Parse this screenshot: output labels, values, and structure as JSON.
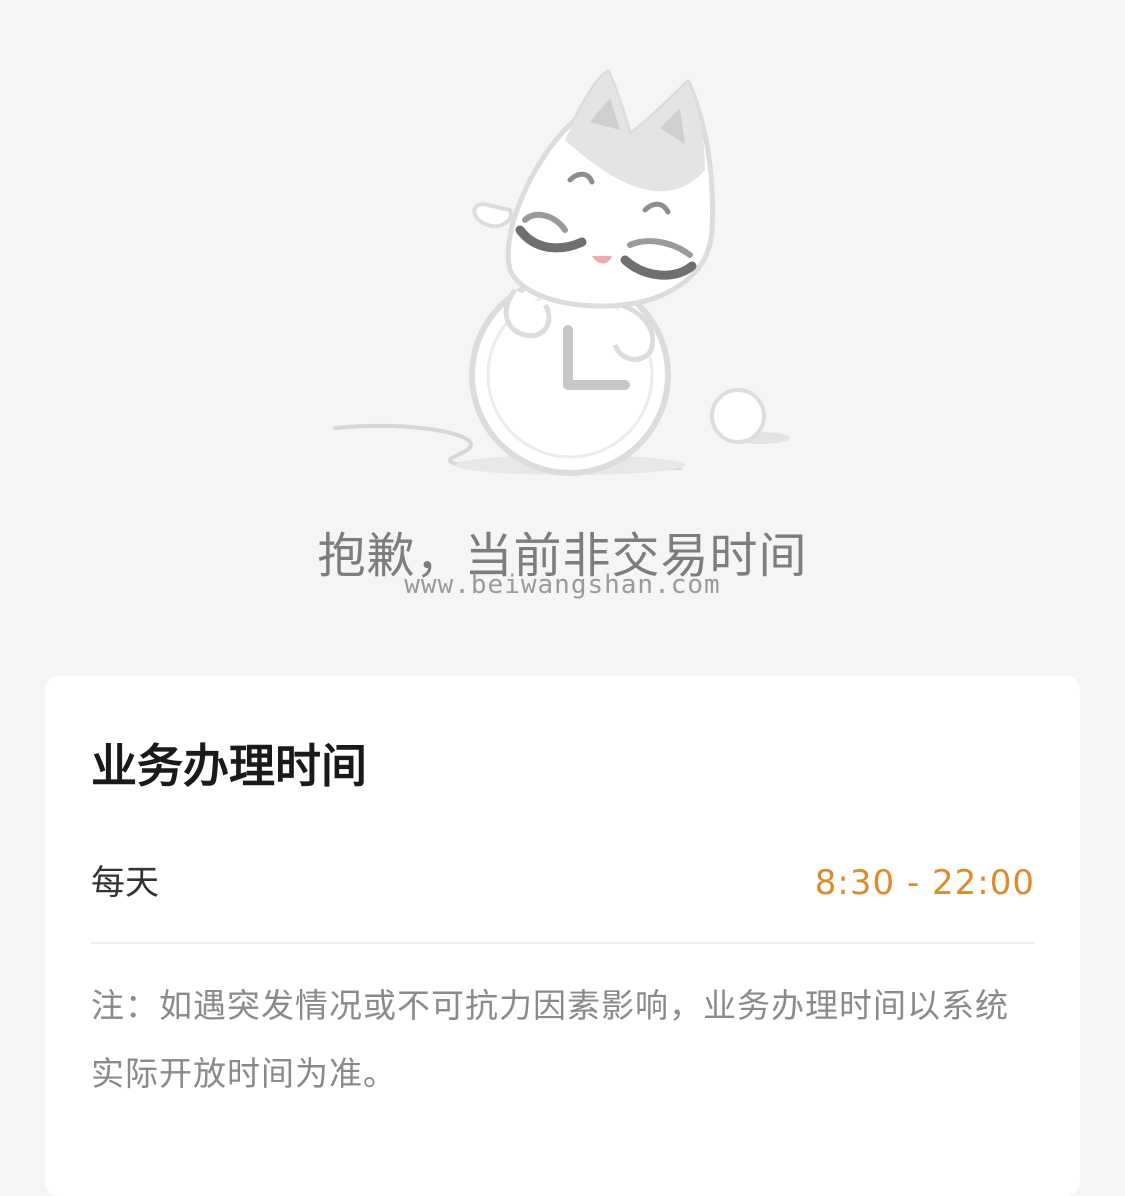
{
  "empty_state": {
    "illustration_icon": "sleeping-cat-clock-icon",
    "title": "抱歉，当前非交易时间",
    "watermark": "www.beiwangshan.com"
  },
  "hours_card": {
    "title": "业务办理时间",
    "schedule": {
      "label": "每天",
      "value": "8:30 - 22:00"
    },
    "note": "注：如遇突发情况或不可抗力因素影响，业务办理时间以系统实际开放时间为准。"
  },
  "colors": {
    "page_background": "#f5f5f5",
    "card_background": "#ffffff",
    "accent": "#e08a2e",
    "muted_text": "#8a8a8a",
    "title_text": "#1a1a1a"
  }
}
